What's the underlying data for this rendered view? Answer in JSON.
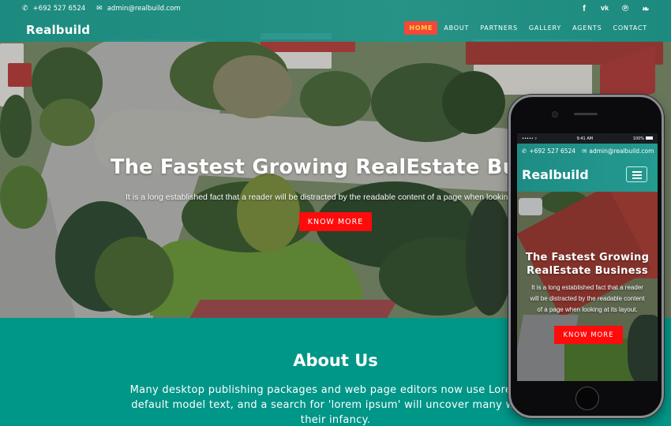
{
  "header": {
    "phone": "+692 527 6524",
    "email": "admin@realbuild.com",
    "phone_icon": "phone-icon",
    "email_icon": "envelope-icon",
    "logo": "Realbuild",
    "social": [
      {
        "name": "facebook-icon",
        "glyph": "f"
      },
      {
        "name": "vk-icon",
        "glyph": "ᴠᴋ"
      },
      {
        "name": "pinterest-icon",
        "glyph": "℗"
      },
      {
        "name": "twitter-icon",
        "glyph": "❧"
      }
    ],
    "nav": [
      {
        "label": "HOME",
        "active": true
      },
      {
        "label": "ABOUT",
        "active": false
      },
      {
        "label": "PARTNERS",
        "active": false
      },
      {
        "label": "GALLERY",
        "active": false
      },
      {
        "label": "AGENTS",
        "active": false
      },
      {
        "label": "CONTACT",
        "active": false
      }
    ]
  },
  "hero": {
    "title": "The Fastest Growing RealEstate Busi",
    "subtitle": "It is a long established fact that a reader will be distracted by the readable content of a page when looking at",
    "button": "KNOW MORE"
  },
  "about": {
    "title": "About Us",
    "text_lines": [
      "Many desktop publishing packages and web page editors now use Lorem Ips",
      "default model text, and a search for 'lorem ipsum' will uncover many web si",
      "their infancy."
    ]
  },
  "mobile": {
    "status": {
      "signal": "••••• ▿",
      "time": "9:41 AM",
      "battery": "100%"
    },
    "phone": "+692 527 6524",
    "email": "admin@realbuild.com",
    "logo": "Realbuild",
    "menu_icon": "hamburger-menu-icon",
    "title_lines": [
      "The Fastest Growing",
      "RealEstate Business"
    ],
    "subtitle_lines": [
      "It is a long established fact that a reader",
      "will be distracted by the readable content",
      "of a page when looking at its layout."
    ],
    "button": "KNOW MORE"
  },
  "colors": {
    "brand_teal": "#009688",
    "nav_active_bg": "#f4473a",
    "nav_active_text": "#ffd33d",
    "cta_red": "#ff0b0b"
  }
}
